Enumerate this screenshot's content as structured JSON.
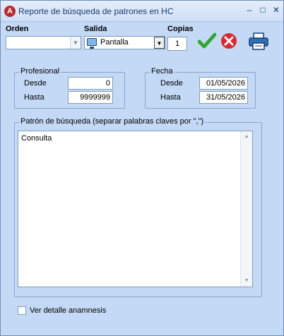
{
  "window": {
    "title": "Reporte de búsqueda de patrones en HC",
    "controls": {
      "minimize": "–",
      "maximize": "□",
      "close": "✕"
    }
  },
  "toolbar": {
    "orden_label": "Orden",
    "orden_value": "",
    "salida_label": "Salida",
    "salida_value": "Pantalla",
    "copias_label": "Copias",
    "copias_value": "1",
    "accept_icon": "check-icon",
    "cancel_icon": "cancel-icon",
    "print_icon": "printer-icon"
  },
  "profesional": {
    "title": "Profesional",
    "desde_label": "Desde",
    "desde_value": "0",
    "hasta_label": "Hasta",
    "hasta_value": "9999999"
  },
  "fecha": {
    "title": "Fecha",
    "desde_label": "Desde",
    "desde_value": "01/05/2026",
    "hasta_label": "Hasta",
    "hasta_value": "31/05/2026"
  },
  "patron": {
    "title": "Patrón de búsqueda (separar palabras claves por \",\")",
    "value": "Consulta"
  },
  "options": {
    "ver_detalle_label": "Ver detalle anamnesis",
    "ver_detalle_checked": false
  },
  "colors": {
    "accept_green": "#2fa82c",
    "cancel_red": "#e0262b",
    "window_bg": "#c3d9f5"
  }
}
